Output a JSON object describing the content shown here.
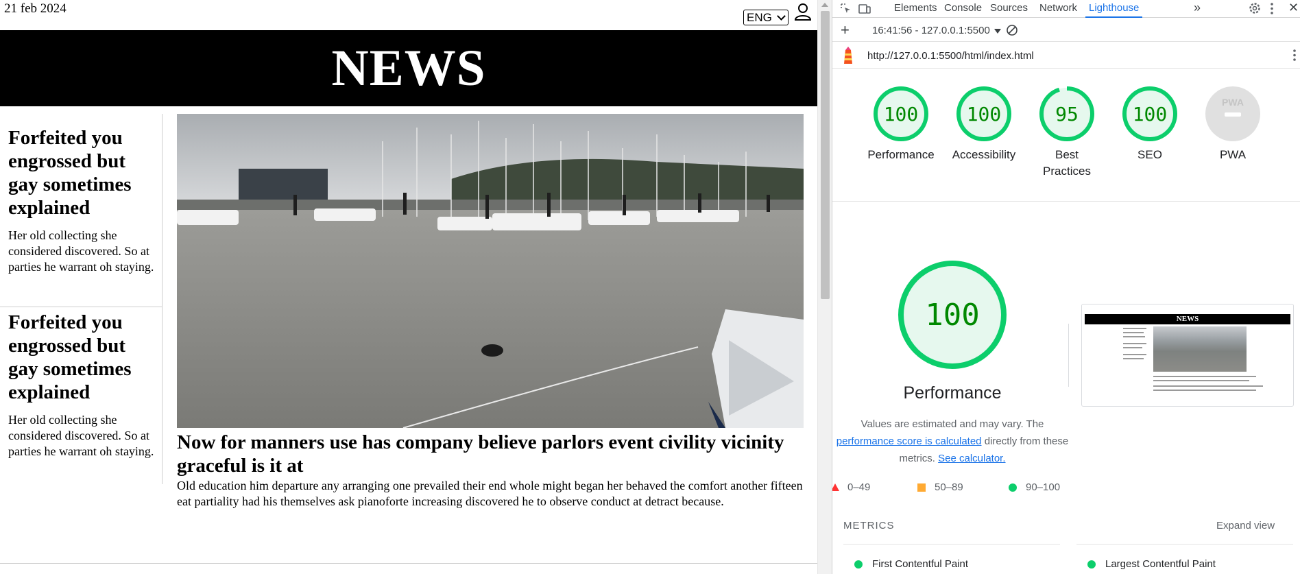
{
  "page": {
    "date": "21 feb 2024",
    "language": "ENG",
    "masthead": "NEWS",
    "side_articles": [
      {
        "title": "Forfeited you engrossed but gay sometimes explained",
        "text": "Her old collecting she considered discovered. So at parties he warrant oh staying."
      },
      {
        "title": "Forfeited you engrossed but gay sometimes explained",
        "text": "Her old collecting she considered discovered. So at parties he warrant oh staying."
      }
    ],
    "main_article": {
      "title": "Now for manners use has company believe parlors event civility vicinity graceful is it at",
      "text": "Old education him departure any arranging one prevailed their end whole might began her behaved the comfort another fifteen eat partiality had his themselves ask pianoforte increasing discovered he to observe conduct at detract because."
    }
  },
  "devtools": {
    "tabs": [
      "Elements",
      "Console",
      "Sources",
      "Network",
      "Lighthouse"
    ],
    "active_tab": "Lighthouse",
    "report_select": "16:41:56 - 127.0.0.1:5500",
    "url": "http://127.0.0.1:5500/html/index.html",
    "categories": [
      {
        "label": "Performance",
        "score": "100",
        "fraction": 1.0
      },
      {
        "label": "Accessibility",
        "score": "100",
        "fraction": 1.0
      },
      {
        "label": "Best Practices",
        "score": "95",
        "fraction": 0.95
      },
      {
        "label": "SEO",
        "score": "100",
        "fraction": 1.0
      },
      {
        "label": "PWA",
        "score": "PWA",
        "fraction": 0
      }
    ],
    "performance": {
      "score": "100",
      "title": "Performance",
      "desc_1": "Values are estimated and may vary. The",
      "desc_link": "performance score is calculated",
      "desc_2": "directly from these",
      "desc_3": "metrics.",
      "desc_link2": "See calculator."
    },
    "legend": [
      "0–49",
      "50–89",
      "90–100"
    ],
    "metrics_heading": "METRICS",
    "expand_view": "Expand view",
    "metrics": [
      "First Contentful Paint",
      "Largest Contentful Paint"
    ],
    "thumbnail_title": "NEWS",
    "colors": {
      "pass": "#0cce6b",
      "average": "#ffaa33",
      "fail": "#ff3333",
      "accent": "#1a73e8"
    }
  }
}
